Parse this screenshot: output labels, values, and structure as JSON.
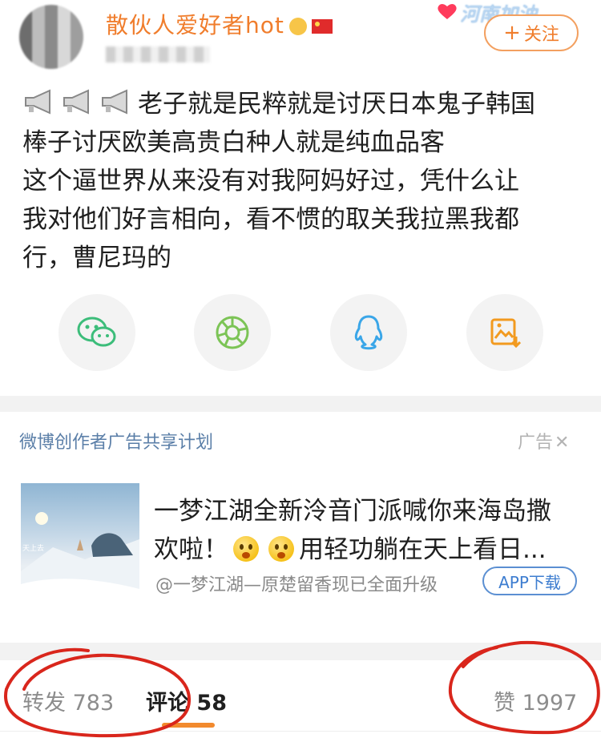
{
  "header": {
    "username": "散伙人爱好者hot",
    "deco_text": "河南加油",
    "follow_button": "关注"
  },
  "post": {
    "lines": [
      "老子就是民粹就是讨厌日本鬼子韩国",
      "棒子讨厌欧美高贵白种人就是纯血品客",
      "这个逼世界从来没有对我阿妈好过，凭什么让",
      "我对他们好言相向，看不惯的取关我拉黑我都",
      "行，曹尼玛的"
    ]
  },
  "share": {
    "icons": [
      "wechat-icon",
      "moments-icon",
      "qq-icon",
      "save-image-icon"
    ]
  },
  "ad": {
    "program": "微博创作者广告共享计划",
    "label": "广告",
    "thumb_text": "天上去",
    "title_line1": "一梦江湖全新泠音门派喊你来海岛撒",
    "title_line2_a": "欢啦！",
    "title_line2_b": "用轻功躺在天上看日...",
    "source": "@一梦江湖—原楚留香现已全面升级",
    "app_button": "APP下载"
  },
  "tabs": {
    "repost_label": "转发",
    "repost_count": "783",
    "comment_label": "评论",
    "comment_count": "58",
    "like_label": "赞",
    "like_count": "1997"
  },
  "colors": {
    "accent_orange": "#f07d2c",
    "link_blue": "#5b7fa8",
    "annotation_red": "#d9261c"
  }
}
